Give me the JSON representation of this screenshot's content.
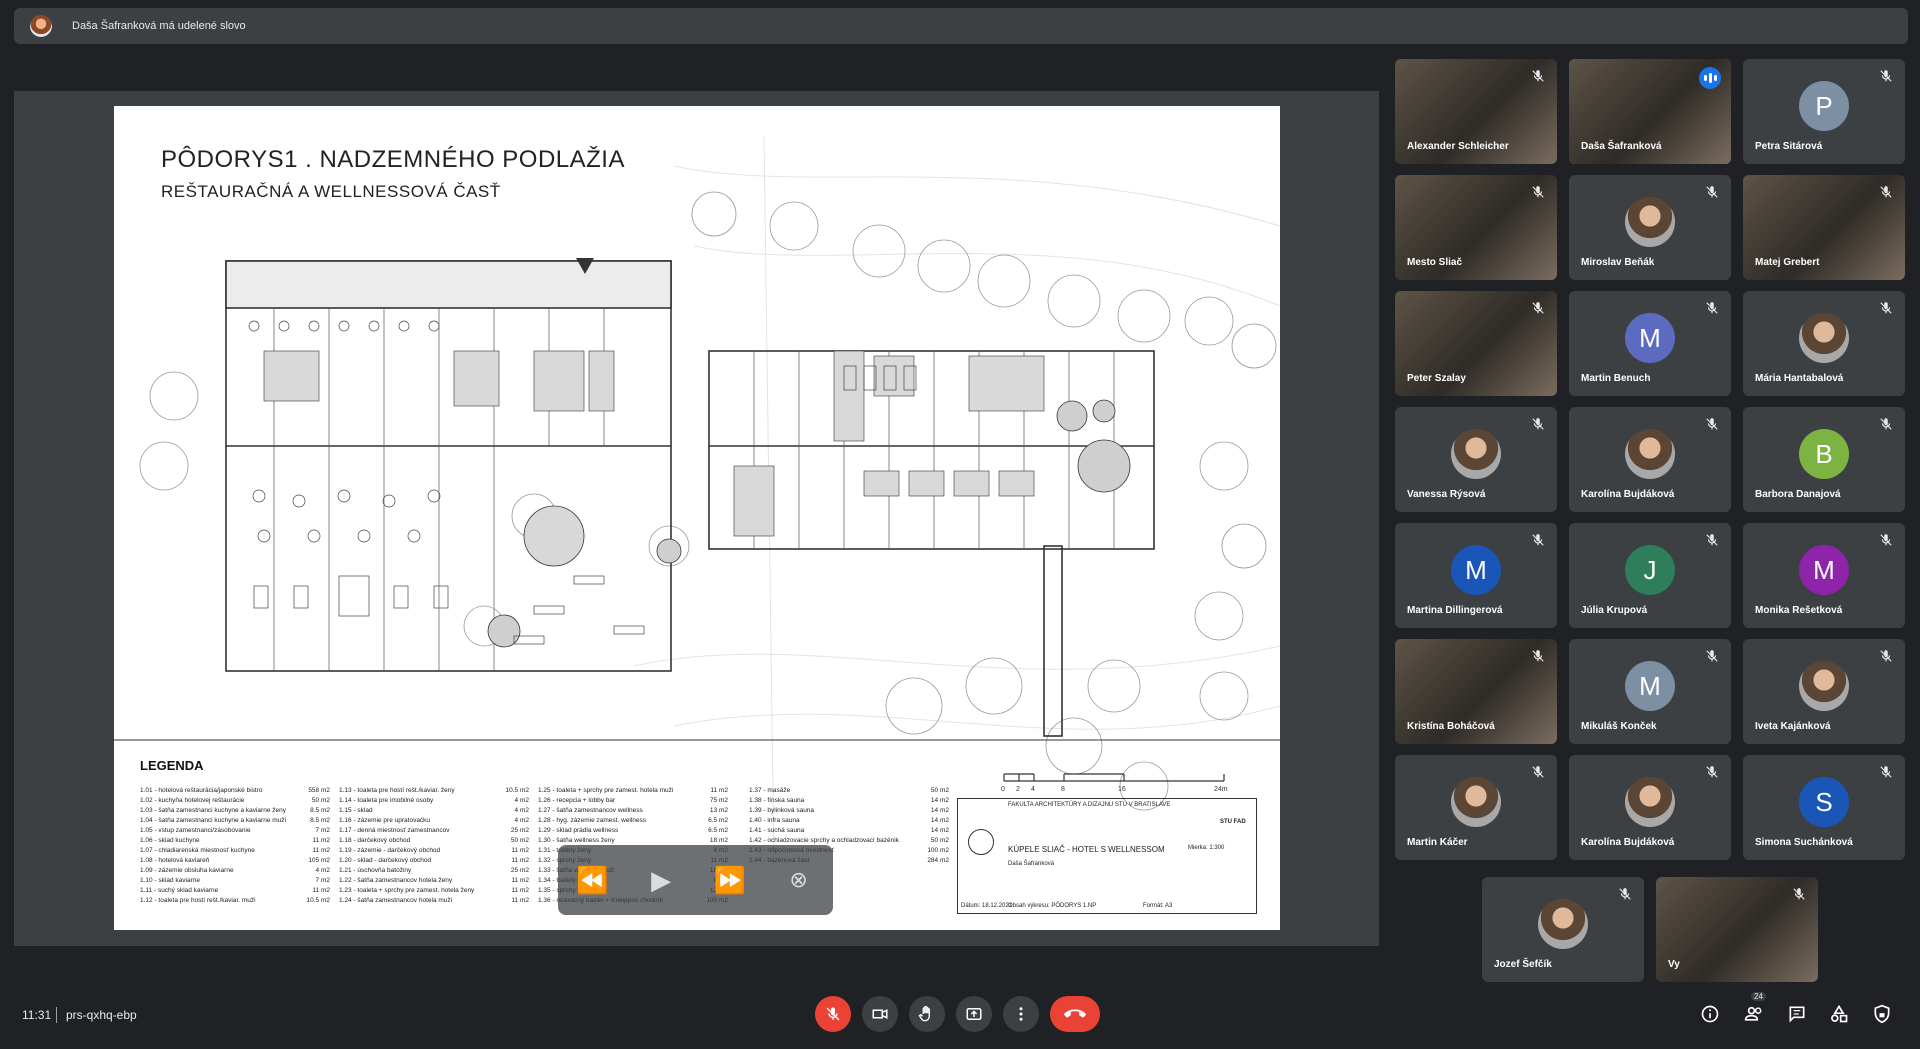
{
  "presenter_bar": {
    "text": "Daša Šafranková má udelené slovo"
  },
  "slide": {
    "title": "PÔDORYS1 . NADZEMNÉHO PODLAŽIA",
    "subtitle": "REŠTAURAČNÁ A WELLNESSOVÁ ČASŤ",
    "legend_title": "LEGENDA",
    "legend_col1": [
      [
        "1.01 - hotelová reštaurácia/japonské bistro",
        "558 m2"
      ],
      [
        "1.02 - kuchyňa hotelovej reštaurácie",
        "50 m2"
      ],
      [
        "1.03 - šatňa zamestnanci kuchyne a kaviarne ženy",
        "8.5 m2"
      ],
      [
        "1.04 - šatňa zamestnanci kuchyne a kaviarne muži",
        "8.5 m2"
      ],
      [
        "1.05 - vstup zamestnanci/zásobovanie",
        "7 m2"
      ],
      [
        "1.06 - sklad kuchyne",
        "11 m2"
      ],
      [
        "1.07 - chladiarenská miestnosť kuchyne",
        "11 m2"
      ],
      [
        "1.08 - hotelová kaviareň",
        "105 m2"
      ],
      [
        "1.09 - zázemie obsluha kaviarne",
        "4 m2"
      ],
      [
        "1.10 - sklad kaviarne",
        "7 m2"
      ],
      [
        "1.11 - suchý sklad kaviarne",
        "11 m2"
      ],
      [
        "1.12 - toaleta pre hostí rešt./kaviar. muži",
        "10.5 m2"
      ]
    ],
    "legend_col2": [
      [
        "1.13 - toaleta pre hostí rešt./kaviar. ženy",
        "10.5 m2"
      ],
      [
        "1.14 - toaleta pre imobilné osoby",
        "4 m2"
      ],
      [
        "1.15 - sklad",
        "4 m2"
      ],
      [
        "1.16 - zázemie pre upratovačku",
        "4 m2"
      ],
      [
        "1.17 - denná miestnosť zamestnancov",
        "25 m2"
      ],
      [
        "1.18 - darčekový obchod",
        "50 m2"
      ],
      [
        "1.19 - zázemie - darčekový obchod",
        "11 m2"
      ],
      [
        "1.20 - sklad - darčekový obchod",
        "11 m2"
      ],
      [
        "1.21 - úschovňa batožiny",
        "25 m2"
      ],
      [
        "1.22 - šatňa zamestnancov hotela ženy",
        "11 m2"
      ],
      [
        "1.23 - toaleta + sprchy pre zamest. hotela ženy",
        "11 m2"
      ],
      [
        "1.24 - šatňa zamestnancov hotela muži",
        "11 m2"
      ]
    ],
    "legend_col3": [
      [
        "1.25 - toaleta + sprchy pre zamest. hotela muži",
        "11 m2"
      ],
      [
        "1.26 - recepcia + lobby bar",
        "75 m2"
      ],
      [
        "1.27 - šatňa zamestnancov wellness",
        "13 m2"
      ],
      [
        "1.28 - hyg. zázemie zamest. wellness",
        "6.5 m2"
      ],
      [
        "1.29 - sklad prádla wellness",
        "6.5 m2"
      ],
      [
        "1.30 - šatňa wellness ženy",
        "18 m2"
      ],
      [
        "1.31 - toalety ženy",
        "8 m2"
      ],
      [
        "1.32 - sprchy ženy",
        "11 m2"
      ],
      [
        "1.33 - šatňa wellness muži",
        "18 m2"
      ],
      [
        "1.34 - toalety muži",
        "8 m2"
      ],
      [
        "1.35 - sprchy muži",
        "12 m2"
      ],
      [
        "1.36 - relaxačný bazén + Kneippov chodník",
        "100 m2"
      ]
    ],
    "legend_col4": [
      [
        "1.37 - masáže",
        "50 m2"
      ],
      [
        "1.38 - fínska sauna",
        "14 m2"
      ],
      [
        "1.39 - bylinková sauna",
        "14 m2"
      ],
      [
        "1.40 - infra sauna",
        "14 m2"
      ],
      [
        "1.41 - suchá sauna",
        "14 m2"
      ],
      [
        "1.42 - ochladzovacie sprchy a ochladzovací bazénik",
        "50 m2"
      ],
      [
        "1.43 - odpočinková miestnosť",
        "100 m2"
      ],
      [
        "1.44 - bazénová časť",
        "284 m2"
      ]
    ],
    "scale_labels": [
      "0",
      "2",
      "4",
      "8",
      "16",
      "24m"
    ],
    "stamp": {
      "school": "FAKULTA ARCHITEKTÚRY A DIZAJNU STU V BRATISLAVE",
      "project": "KÚPELE SLIAČ - HOTEL S WELLNESSOM",
      "author": "Daša Šafranková",
      "date": "Dátum: 18.12.2021",
      "content": "Obsah výkresu: PÔDORYS 1.NP",
      "format": "Formát: A3",
      "scale": "Mierka: 1:300",
      "logo": "STU FAD"
    }
  },
  "participants": [
    {
      "name": "Alexander Schleicher",
      "kind": "video",
      "active": false
    },
    {
      "name": "Daša Šafranková",
      "kind": "video",
      "active": true
    },
    {
      "name": "Petra Sitárová",
      "kind": "letter",
      "letter": "P",
      "color": "#7c8fa3"
    },
    {
      "name": "Mesto Sliač",
      "kind": "video"
    },
    {
      "name": "Miroslav Beňák",
      "kind": "photo"
    },
    {
      "name": "Matej Grebert",
      "kind": "video"
    },
    {
      "name": "Peter Szalay",
      "kind": "video"
    },
    {
      "name": "Martin Benuch",
      "kind": "letter",
      "letter": "M",
      "color": "#5c6bc0"
    },
    {
      "name": "Mária Hantabalová",
      "kind": "photo"
    },
    {
      "name": "Vanessa Rýsová",
      "kind": "photo"
    },
    {
      "name": "Karolína Bujdáková",
      "kind": "photo"
    },
    {
      "name": "Barbora Danajová",
      "kind": "letter",
      "letter": "B",
      "color": "#7cb342"
    },
    {
      "name": "Martina Dillingerová",
      "kind": "letter",
      "letter": "M",
      "color": "#1a56b8"
    },
    {
      "name": "Júlia Krupová",
      "kind": "letter",
      "letter": "J",
      "color": "#2e7d5b"
    },
    {
      "name": "Monika Rešetková",
      "kind": "letter",
      "letter": "M",
      "color": "#8e24aa"
    },
    {
      "name": "Kristína Boháčová",
      "kind": "video"
    },
    {
      "name": "Mikuláš Konček",
      "kind": "letter",
      "letter": "M",
      "color": "#7c8fa3"
    },
    {
      "name": "Iveta Kajánková",
      "kind": "photo"
    },
    {
      "name": "Martin Káčer",
      "kind": "photo"
    },
    {
      "name": "Karolína Bujdáková",
      "kind": "photo"
    },
    {
      "name": "Simona Suchánková",
      "kind": "letter",
      "letter": "S",
      "color": "#1a56b8"
    },
    {
      "name": "Jozef Šefčík",
      "kind": "photo"
    },
    {
      "name": "Vy",
      "kind": "video"
    }
  ],
  "bottom_bar": {
    "time": "11:31",
    "meeting_code": "prs-qxhq-ebp",
    "participants_count": "24"
  },
  "icons": {
    "mic_off": "mic-off-icon",
    "camera": "camera-icon",
    "hand": "raise-hand-icon",
    "present": "present-icon",
    "more": "more-icon",
    "leave": "leave-call-icon"
  }
}
